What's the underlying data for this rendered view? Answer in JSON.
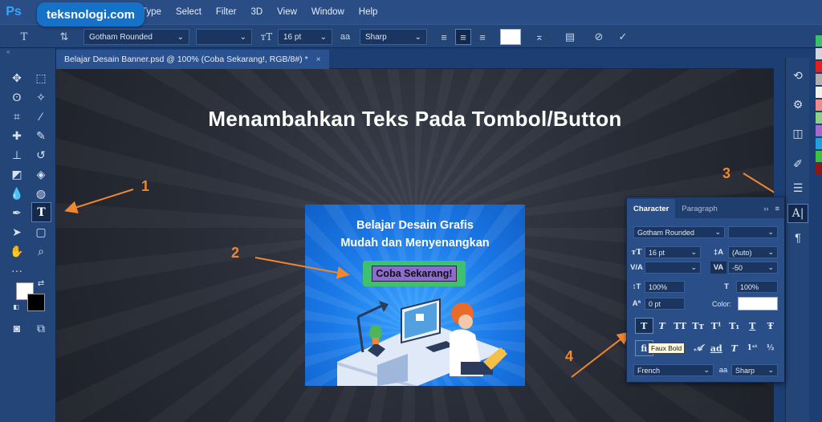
{
  "app": {
    "logo": "Ps",
    "brand_watermark": "teksnologi.com"
  },
  "menu": [
    "Type",
    "Select",
    "Filter",
    "3D",
    "View",
    "Window",
    "Help"
  ],
  "options_bar": {
    "font_family": "Gotham Rounded",
    "font_size": "16 pt",
    "anti_alias_label": "aa",
    "anti_alias": "Sharp"
  },
  "document_tab": {
    "title": "Belajar Desain Banner.psd @ 100% (Coba Sekarang!, RGB/8#) *",
    "close": "×"
  },
  "canvas": {
    "headline": "Menambahkan Teks Pada Tombol/Button",
    "banner": {
      "line1": "Belajar Desain Grafis",
      "line2": "Mudah dan Menyenangkan",
      "button_text": "Coba Sekarang!"
    },
    "annotations": [
      "1",
      "2",
      "3",
      "4"
    ],
    "accent_color": "#f0872e"
  },
  "character_panel": {
    "tabs": [
      "Character",
      "Paragraph"
    ],
    "font_family": "Gotham Rounded",
    "font_size": "16 pt",
    "leading": "(Auto)",
    "tracking": "-50",
    "vertical_scale": "100%",
    "horizontal_scale": "100%",
    "baseline_shift": "0 pt",
    "color_label": "Color:",
    "style_buttons": [
      "T",
      "T",
      "TT",
      "Tт",
      "T¹",
      "T₁",
      "T",
      "Ŧ"
    ],
    "tooltip": "Faux Bold",
    "language": "French",
    "aa_label": "aa",
    "anti_alias": "Sharp"
  }
}
